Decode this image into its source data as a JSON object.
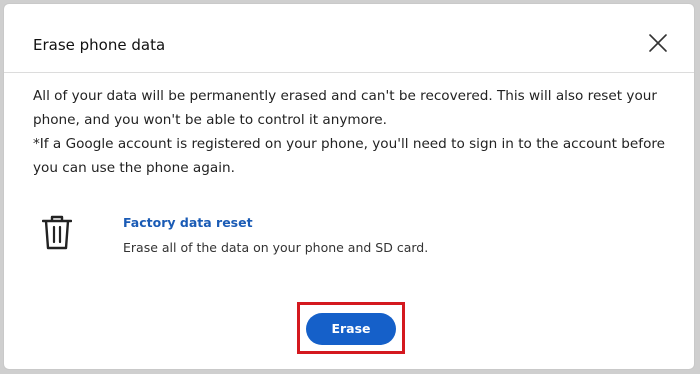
{
  "dialog": {
    "title": "Erase phone data",
    "close_icon": "close-icon",
    "description_lines": [
      "All of your data will be permanently erased and can't be recovered. This will also reset your",
      "phone, and you won't be able to control it anymore.",
      "*If a Google account is registered on your phone, you'll need to sign in to the account before",
      "you can use the phone again."
    ],
    "option": {
      "icon": "trash-icon",
      "title": "Factory data reset",
      "description": "Erase all of the data on your phone and SD card."
    },
    "erase_button": {
      "label": "Erase",
      "color": "#1560c9"
    },
    "highlight_color": "#d4181f"
  }
}
